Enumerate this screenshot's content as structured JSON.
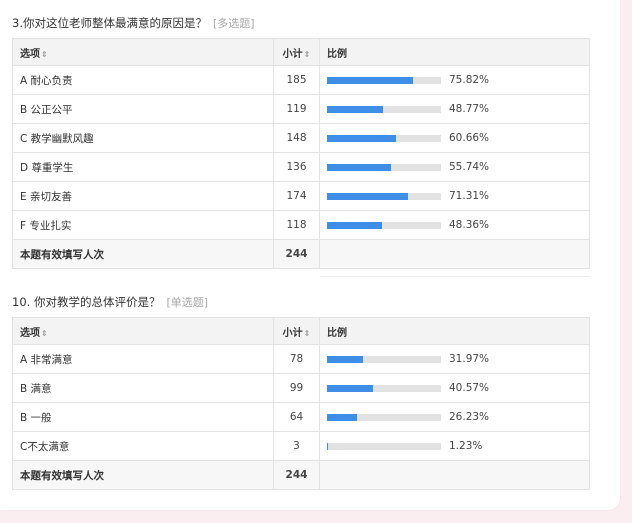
{
  "questions": [
    {
      "title": "3.你对这位老师整体最满意的原因是？",
      "type": "[多选题]",
      "headers": {
        "option": "选项",
        "count": "小计",
        "ratio": "比例",
        "sort_icon": "⇕"
      },
      "rows": [
        {
          "option": "A 耐心负责",
          "count": "185",
          "pct": "75.82%",
          "value": 75.82
        },
        {
          "option": "B 公正公平",
          "count": "119",
          "pct": "48.77%",
          "value": 48.77
        },
        {
          "option": "C 教学幽默风趣",
          "count": "148",
          "pct": "60.66%",
          "value": 60.66
        },
        {
          "option": "D 尊重学生",
          "count": "136",
          "pct": "55.74%",
          "value": 55.74
        },
        {
          "option": "E 亲切友善",
          "count": "174",
          "pct": "71.31%",
          "value": 71.31
        },
        {
          "option": "F 专业扎实",
          "count": "118",
          "pct": "48.36%",
          "value": 48.36
        }
      ],
      "total_label": "本题有效填写人次",
      "total": "244"
    },
    {
      "title": "10. 你对教学的总体评价是？",
      "type": "[单选题]",
      "headers": {
        "option": "选项",
        "count": "小计",
        "ratio": "比例",
        "sort_icon": "⇕"
      },
      "rows": [
        {
          "option": "A 非常满意",
          "count": "78",
          "pct": "31.97%",
          "value": 31.97
        },
        {
          "option": "B 满意",
          "count": "99",
          "pct": "40.57%",
          "value": 40.57
        },
        {
          "option": "B 一般",
          "count": "64",
          "pct": "26.23%",
          "value": 26.23
        },
        {
          "option": "C不太满意",
          "count": "3",
          "pct": "1.23%",
          "value": 1.23
        }
      ],
      "total_label": "本题有效填写人次",
      "total": "244"
    }
  ],
  "colors": {
    "bar": "#3e8ee8",
    "track": "#e2e2e2"
  }
}
